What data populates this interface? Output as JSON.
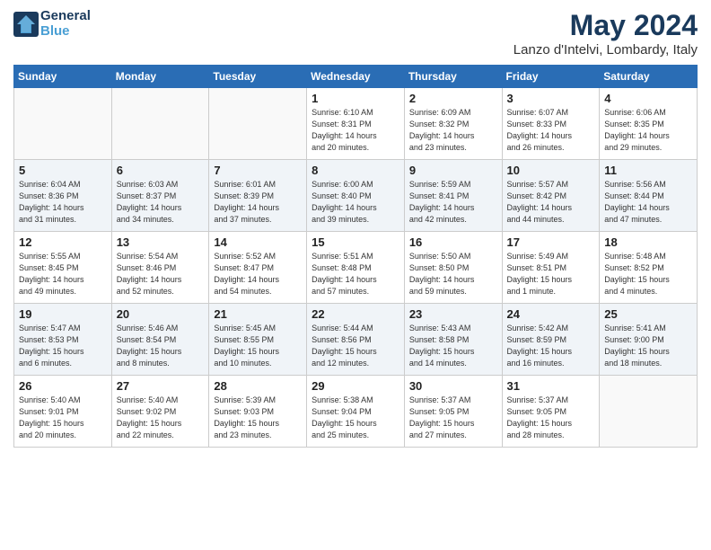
{
  "header": {
    "logo_line1": "General",
    "logo_line2": "Blue",
    "title": "May 2024",
    "subtitle": "Lanzo d'Intelvi, Lombardy, Italy"
  },
  "weekdays": [
    "Sunday",
    "Monday",
    "Tuesday",
    "Wednesday",
    "Thursday",
    "Friday",
    "Saturday"
  ],
  "weeks": [
    [
      {
        "day": "",
        "info": ""
      },
      {
        "day": "",
        "info": ""
      },
      {
        "day": "",
        "info": ""
      },
      {
        "day": "1",
        "info": "Sunrise: 6:10 AM\nSunset: 8:31 PM\nDaylight: 14 hours\nand 20 minutes."
      },
      {
        "day": "2",
        "info": "Sunrise: 6:09 AM\nSunset: 8:32 PM\nDaylight: 14 hours\nand 23 minutes."
      },
      {
        "day": "3",
        "info": "Sunrise: 6:07 AM\nSunset: 8:33 PM\nDaylight: 14 hours\nand 26 minutes."
      },
      {
        "day": "4",
        "info": "Sunrise: 6:06 AM\nSunset: 8:35 PM\nDaylight: 14 hours\nand 29 minutes."
      }
    ],
    [
      {
        "day": "5",
        "info": "Sunrise: 6:04 AM\nSunset: 8:36 PM\nDaylight: 14 hours\nand 31 minutes."
      },
      {
        "day": "6",
        "info": "Sunrise: 6:03 AM\nSunset: 8:37 PM\nDaylight: 14 hours\nand 34 minutes."
      },
      {
        "day": "7",
        "info": "Sunrise: 6:01 AM\nSunset: 8:39 PM\nDaylight: 14 hours\nand 37 minutes."
      },
      {
        "day": "8",
        "info": "Sunrise: 6:00 AM\nSunset: 8:40 PM\nDaylight: 14 hours\nand 39 minutes."
      },
      {
        "day": "9",
        "info": "Sunrise: 5:59 AM\nSunset: 8:41 PM\nDaylight: 14 hours\nand 42 minutes."
      },
      {
        "day": "10",
        "info": "Sunrise: 5:57 AM\nSunset: 8:42 PM\nDaylight: 14 hours\nand 44 minutes."
      },
      {
        "day": "11",
        "info": "Sunrise: 5:56 AM\nSunset: 8:44 PM\nDaylight: 14 hours\nand 47 minutes."
      }
    ],
    [
      {
        "day": "12",
        "info": "Sunrise: 5:55 AM\nSunset: 8:45 PM\nDaylight: 14 hours\nand 49 minutes."
      },
      {
        "day": "13",
        "info": "Sunrise: 5:54 AM\nSunset: 8:46 PM\nDaylight: 14 hours\nand 52 minutes."
      },
      {
        "day": "14",
        "info": "Sunrise: 5:52 AM\nSunset: 8:47 PM\nDaylight: 14 hours\nand 54 minutes."
      },
      {
        "day": "15",
        "info": "Sunrise: 5:51 AM\nSunset: 8:48 PM\nDaylight: 14 hours\nand 57 minutes."
      },
      {
        "day": "16",
        "info": "Sunrise: 5:50 AM\nSunset: 8:50 PM\nDaylight: 14 hours\nand 59 minutes."
      },
      {
        "day": "17",
        "info": "Sunrise: 5:49 AM\nSunset: 8:51 PM\nDaylight: 15 hours\nand 1 minute."
      },
      {
        "day": "18",
        "info": "Sunrise: 5:48 AM\nSunset: 8:52 PM\nDaylight: 15 hours\nand 4 minutes."
      }
    ],
    [
      {
        "day": "19",
        "info": "Sunrise: 5:47 AM\nSunset: 8:53 PM\nDaylight: 15 hours\nand 6 minutes."
      },
      {
        "day": "20",
        "info": "Sunrise: 5:46 AM\nSunset: 8:54 PM\nDaylight: 15 hours\nand 8 minutes."
      },
      {
        "day": "21",
        "info": "Sunrise: 5:45 AM\nSunset: 8:55 PM\nDaylight: 15 hours\nand 10 minutes."
      },
      {
        "day": "22",
        "info": "Sunrise: 5:44 AM\nSunset: 8:56 PM\nDaylight: 15 hours\nand 12 minutes."
      },
      {
        "day": "23",
        "info": "Sunrise: 5:43 AM\nSunset: 8:58 PM\nDaylight: 15 hours\nand 14 minutes."
      },
      {
        "day": "24",
        "info": "Sunrise: 5:42 AM\nSunset: 8:59 PM\nDaylight: 15 hours\nand 16 minutes."
      },
      {
        "day": "25",
        "info": "Sunrise: 5:41 AM\nSunset: 9:00 PM\nDaylight: 15 hours\nand 18 minutes."
      }
    ],
    [
      {
        "day": "26",
        "info": "Sunrise: 5:40 AM\nSunset: 9:01 PM\nDaylight: 15 hours\nand 20 minutes."
      },
      {
        "day": "27",
        "info": "Sunrise: 5:40 AM\nSunset: 9:02 PM\nDaylight: 15 hours\nand 22 minutes."
      },
      {
        "day": "28",
        "info": "Sunrise: 5:39 AM\nSunset: 9:03 PM\nDaylight: 15 hours\nand 23 minutes."
      },
      {
        "day": "29",
        "info": "Sunrise: 5:38 AM\nSunset: 9:04 PM\nDaylight: 15 hours\nand 25 minutes."
      },
      {
        "day": "30",
        "info": "Sunrise: 5:37 AM\nSunset: 9:05 PM\nDaylight: 15 hours\nand 27 minutes."
      },
      {
        "day": "31",
        "info": "Sunrise: 5:37 AM\nSunset: 9:05 PM\nDaylight: 15 hours\nand 28 minutes."
      },
      {
        "day": "",
        "info": ""
      }
    ]
  ]
}
